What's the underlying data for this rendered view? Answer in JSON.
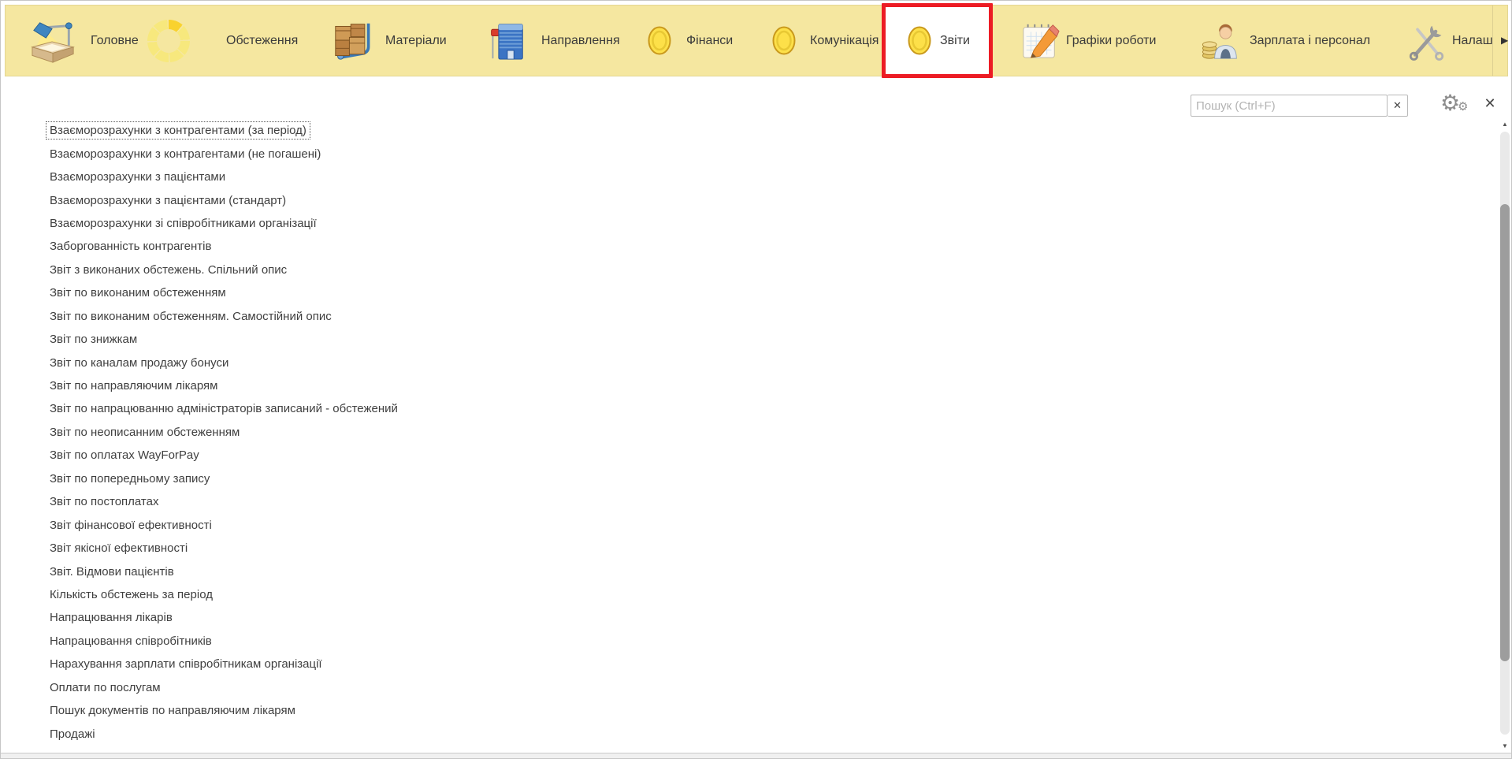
{
  "menu": {
    "items": [
      {
        "label": "Головне",
        "icon": "desk-lamp-icon"
      },
      {
        "label": "Обстеження",
        "icon": "loading-ring-icon"
      },
      {
        "label": "Матеріали",
        "icon": "crates-icon"
      },
      {
        "label": "Направлення",
        "icon": "building-flag-icon"
      },
      {
        "label": "Фінанси",
        "icon": "coin-icon"
      },
      {
        "label": "Комунікація",
        "icon": "coin-icon"
      },
      {
        "label": "Звіти",
        "icon": "coin-icon"
      },
      {
        "label": "Графіки роботи",
        "icon": "notepad-pencil-icon"
      },
      {
        "label": "Зарплата і персонал",
        "icon": "person-coins-icon"
      },
      {
        "label": "Налаш",
        "icon": "tools-icon"
      }
    ],
    "selected_label": "Звіти"
  },
  "toolbar": {
    "search_placeholder": "Пошук (Ctrl+F)"
  },
  "icons": {
    "clear_glyph": "✕",
    "close_glyph": "✕",
    "gear_glyph": "⚙",
    "overflow_arrow_glyph": "▶",
    "scroll_up_glyph": "▲",
    "scroll_down_glyph": "▼"
  },
  "report_list": {
    "selected_index": 0,
    "items": [
      "Взаєморозрахунки з контрагентами (за період)",
      "Взаєморозрахунки з контрагентами (не погашені)",
      "Взаєморозрахунки з пацієнтами",
      "Взаєморозрахунки з пацієнтами (стандарт)",
      "Взаєморозрахунки зі співробітниками організації",
      "Заборгованність контрагентів",
      "Звіт з виконаних обстежень. Спільний опис",
      "Звіт по виконаним обстеженням",
      "Звіт по виконаним обстеженням. Самостійний опис",
      "Звіт по знижкам",
      "Звіт по каналам продажу бонуси",
      "Звіт по направляючим лікарям",
      "Звіт по напрацюванню адміністраторів записаний - обстежений",
      "Звіт по неописанним обстеженням",
      "Звіт по оплатах WayForPay",
      "Звіт по попередньому запису",
      "Звіт по постоплатах",
      "Звіт фінансової ефективності",
      "Звіт якісної ефективності",
      "Звіт. Відмови пацієнтів",
      "Кількість обстежень за період",
      "Напрацювання лікарів",
      "Напрацювання співробітників",
      "Нарахування зарплати співробітникам організації",
      "Оплати по послугам",
      "Пошук документів по направляючим лікарям",
      "Продажі"
    ]
  },
  "colors": {
    "menu_bar": "#f5e7a0",
    "highlight_border": "#ec1c24",
    "link_text": "#3f3f3f"
  }
}
